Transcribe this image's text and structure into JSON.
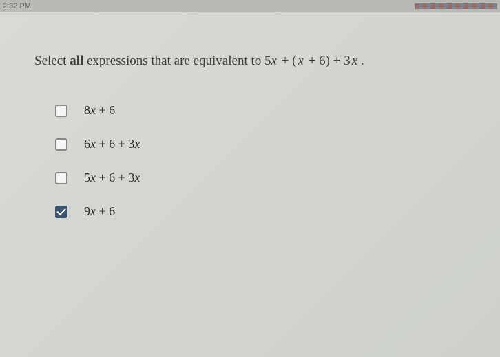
{
  "clock": "2:32 PM",
  "question": {
    "prefix": "Select ",
    "bold": "all",
    "middle": " expressions that are equivalent to ",
    "expr_a": "5",
    "expr_b": "x",
    "expr_c": " + (",
    "expr_d": "x",
    "expr_e": " + 6) + 3",
    "expr_f": "x",
    "expr_g": " ."
  },
  "options": [
    {
      "checked": false,
      "parts": [
        "8",
        "x",
        " + 6"
      ]
    },
    {
      "checked": false,
      "parts": [
        "6",
        "x",
        " + 6 + 3",
        "x"
      ]
    },
    {
      "checked": false,
      "parts": [
        "5",
        "x",
        " + 6 + 3",
        "x"
      ]
    },
    {
      "checked": true,
      "parts": [
        "9",
        "x",
        " + 6"
      ]
    }
  ]
}
